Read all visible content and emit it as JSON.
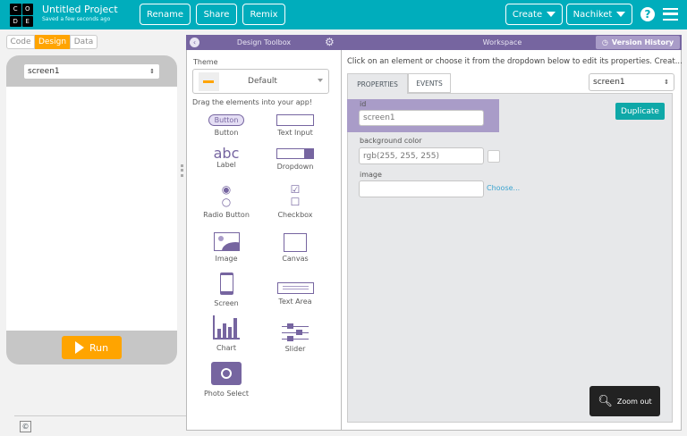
{
  "header": {
    "logo_letters": [
      "C",
      "O",
      "D",
      "E"
    ],
    "project_title": "Untitled Project",
    "saved_status": "Saved a few seconds ago",
    "rename": "Rename",
    "share": "Share",
    "remix": "Remix",
    "create": "Create",
    "user": "Nachiket"
  },
  "mode_tabs": [
    "Code",
    "Design",
    "Data"
  ],
  "app_preview": {
    "screen_select": "screen1",
    "run": "Run"
  },
  "toolbox": {
    "title": "Design Toolbox",
    "theme_label": "Theme",
    "theme_value": "Default",
    "hint": "Drag the elements into your app!",
    "tools": [
      "Button",
      "Text Input",
      "Label",
      "Dropdown",
      "Radio Button",
      "Checkbox",
      "Image",
      "Canvas",
      "Screen",
      "Text Area",
      "Chart",
      "Slider",
      "Photo Select"
    ],
    "button_preview": "Button",
    "label_preview": "abc"
  },
  "workspace": {
    "title": "Workspace",
    "version_history": "Version History",
    "instructions": "Click on an element or choose it from the dropdown below to edit its properties. Creat...",
    "tabs": [
      "PROPERTIES",
      "EVENTS"
    ],
    "element_select": "screen1",
    "duplicate": "Duplicate",
    "props": {
      "id_label": "id",
      "id_value": "screen1",
      "bg_label": "background color",
      "bg_value": "rgb(255, 255, 255)",
      "image_label": "image",
      "image_value": "",
      "choose": "Choose..."
    },
    "zoom_out": "Zoom out"
  },
  "footer": {
    "copyright": "©"
  },
  "colors": {
    "header": "#00adbc",
    "purple": "#7665a0",
    "orange": "#ffa400",
    "teal_button": "#0fa8a8"
  }
}
